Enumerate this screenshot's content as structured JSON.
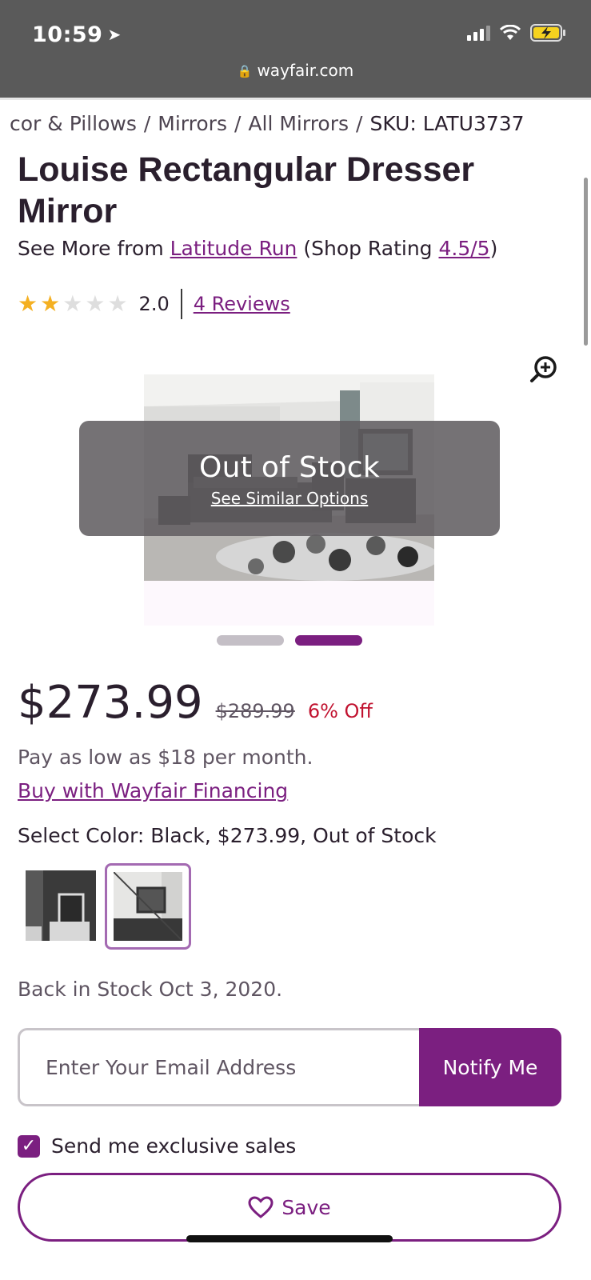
{
  "status_bar": {
    "time": "10:59"
  },
  "browser": {
    "url": "wayfair.com"
  },
  "breadcrumb": {
    "items": [
      "cor & Pillows",
      "Mirrors",
      "All Mirrors"
    ],
    "separator": "/",
    "sku": "SKU: LATU3737"
  },
  "product": {
    "title": "Louise Rectangular Dresser Mirror",
    "see_more_prefix": "See More from ",
    "brand": "Latitude Run",
    "shop_rating_prefix": " (Shop Rating ",
    "shop_rating": "4.5/5",
    "shop_rating_suffix": ")",
    "rating_value": "2.0",
    "rating_stars": 2,
    "rating_max": 5,
    "reviews_link": "4 Reviews"
  },
  "gallery": {
    "overlay_title": "Out of Stock",
    "overlay_link": "See Similar Options",
    "slide_count": 2,
    "active_slide": 2
  },
  "pricing": {
    "price": "$273.99",
    "was_price": "$289.99",
    "discount": "6% Off",
    "pay_low": "Pay as low as $18 per month.",
    "financing_link": "Buy with Wayfair Financing"
  },
  "color_select": {
    "label": "Select Color: Black, $273.99, Out of Stock"
  },
  "stock": {
    "back_in_stock": "Back in Stock Oct 3, 2020."
  },
  "notify": {
    "email_placeholder": "Enter Your Email Address",
    "button_label": "Notify Me",
    "checkbox_label": "Send me exclusive sales",
    "checkbox_checked": true
  },
  "save": {
    "label": "Save"
  },
  "colors": {
    "brand_purple": "#7b1f80",
    "discount_red": "#c11330",
    "star_gold": "#f4b022"
  }
}
